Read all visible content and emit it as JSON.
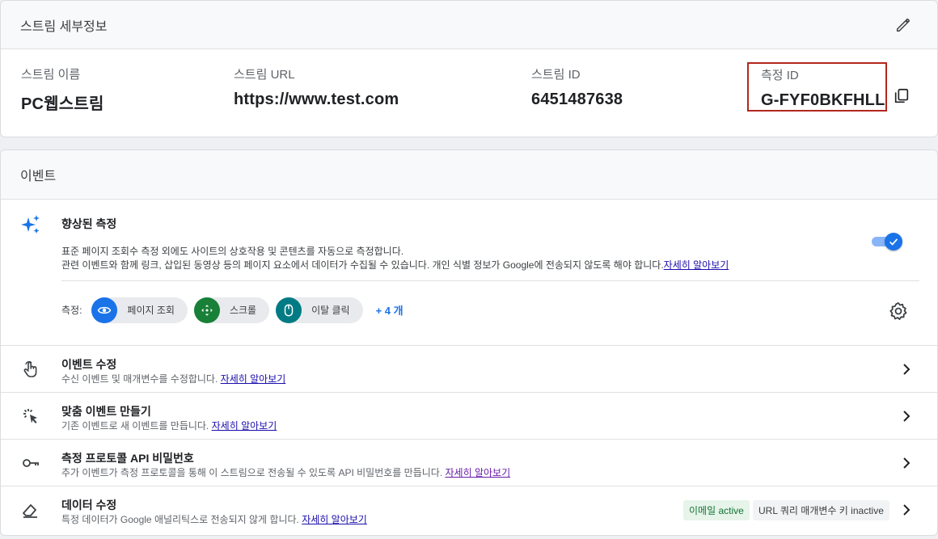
{
  "details": {
    "title": "스트림 세부정보",
    "fields": [
      {
        "label": "스트림 이름",
        "value": "PC웹스트림"
      },
      {
        "label": "스트림 URL",
        "value": "https://www.test.com"
      },
      {
        "label": "스트림 ID",
        "value": "6451487638"
      },
      {
        "label": "측정 ID",
        "value": "G-FYF0BKFHLL"
      }
    ],
    "icons": {
      "edit": "pencil-icon",
      "copy": "copy-icon"
    }
  },
  "events": {
    "title": "이벤트",
    "enhanced": {
      "title": "향상된 측정",
      "desc1": "표준 페이지 조회수 측정 외에도 사이트의 상호작용 및 콘텐츠를 자동으로 측정합니다.",
      "desc2": "관련 이벤트와 함께 링크, 삽입된 동영상 등의 페이지 요소에서 데이터가 수집될 수 있습니다. 개인 식별 정보가 Google에 전송되지 않도록 해야 합니다.",
      "learn_more": "자세히 알아보기",
      "toggle_on": true,
      "measure_label": "측정:",
      "chips": [
        {
          "label": "페이지 조회",
          "color": "#1a73e8",
          "icon": "eye-icon"
        },
        {
          "label": "스크롤",
          "color": "#188038",
          "icon": "scroll-icon"
        },
        {
          "label": "이탈 클릭",
          "color": "#007b83",
          "icon": "mouse-icon"
        }
      ],
      "more": "+ 4 개"
    },
    "rows": [
      {
        "title": "이벤트 수정",
        "desc": "수신 이벤트 및 매개변수를 수정합니다.",
        "link": "자세히 알아보기",
        "icon": "touch-icon"
      },
      {
        "title": "맞춤 이벤트 만들기",
        "desc": "기존 이벤트로 새 이벤트를 만듭니다.",
        "link": "자세히 알아보기",
        "icon": "click-icon"
      },
      {
        "title": "측정 프로토콜 API 비밀번호",
        "desc": "추가 이벤트가 측정 프로토콜을 통해 이 스트림으로 전송될 수 있도록 API 비밀번호를 만듭니다.",
        "link": "자세히 알아보기",
        "icon": "key-icon"
      },
      {
        "title": "데이터 수정",
        "desc": "특정 데이터가 Google 애널리틱스로 전송되지 않게 합니다.",
        "link": "자세히 알아보기",
        "icon": "eraser-icon"
      }
    ],
    "badges": {
      "active": "이메일 active",
      "inactive": "URL 쿼리 매개변수 키 inactive"
    }
  },
  "colors": {
    "accent": "#1a73e8",
    "highlight_border": "#b3261e"
  }
}
